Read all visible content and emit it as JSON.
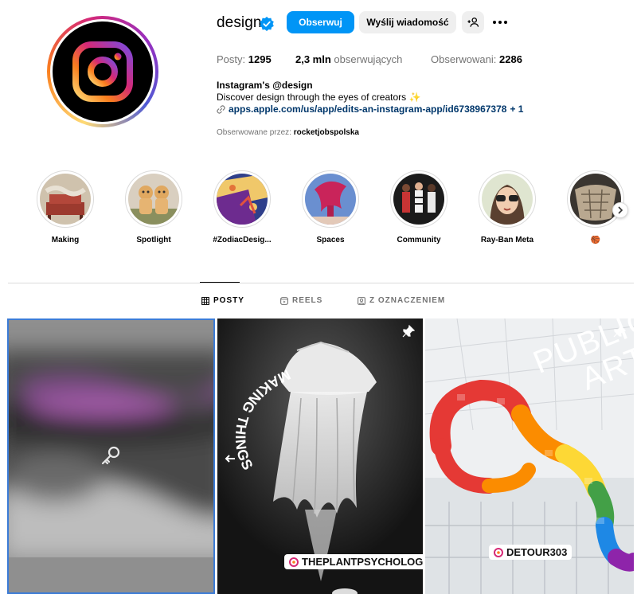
{
  "profile": {
    "username": "design",
    "follow_label": "Obserwuj",
    "message_label": "Wyślij wiadomość",
    "stats": {
      "posts_label": "Posty:",
      "posts_value": "1295",
      "followers_value": "2,3 mln",
      "followers_label": "obserwujących",
      "following_label": "Obserwowani:",
      "following_value": "2286"
    },
    "bio_name": "Instagram's @design",
    "bio_text": "Discover design through the eyes of creators",
    "bio_emoji": "✨",
    "link": "apps.apple.com/us/app/edits-an-instagram-app/id6738967378",
    "link_more": "+ 1",
    "followed_by_label": "Obserwowane przez:",
    "followed_by_user": "rocketjobspolska"
  },
  "highlights": [
    {
      "label": "Making"
    },
    {
      "label": "Spotlight"
    },
    {
      "label": "#ZodiacDesig..."
    },
    {
      "label": "Spaces"
    },
    {
      "label": "Community"
    },
    {
      "label": "Ray-Ban Meta"
    },
    {
      "label": "🏀"
    }
  ],
  "tabs": [
    {
      "label": "POSTY"
    },
    {
      "label": "REELS"
    },
    {
      "label": "Z OZNACZENIEM"
    }
  ],
  "posts": [
    {
      "overlay": ""
    },
    {
      "overlay": "MAKING THINGS",
      "tag": "THEPLANTPSYCHOLOGIST"
    },
    {
      "overlay_line1": "PUBLIC",
      "overlay_line2": "ART",
      "tag": "DETOUR303"
    }
  ],
  "colors": {
    "accent": "#0095f6",
    "link": "#00376b",
    "secondary_text": "#737373",
    "button_bg": "#efefef"
  }
}
